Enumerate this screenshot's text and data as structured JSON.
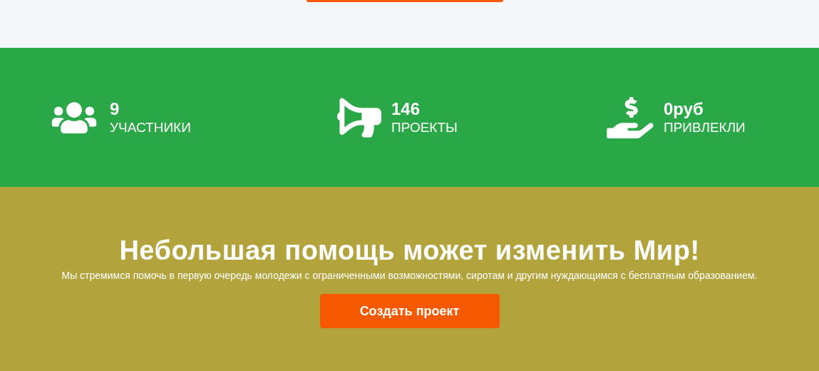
{
  "stats": [
    {
      "value": "9",
      "label": "УЧАСТНИКИ"
    },
    {
      "value": "146",
      "label": "ПРОЕКТЫ"
    },
    {
      "value": "0руб",
      "label": "ПРИВЛЕКЛИ"
    }
  ],
  "cta": {
    "title": "Небольшая помощь может изменить Мир!",
    "text": "Мы стремимся помочь в первую очередь молодежи с ограниченными возможностями, сиротам и другим нуждающимся с бесплатным образованием.",
    "button": "Создать проект"
  }
}
